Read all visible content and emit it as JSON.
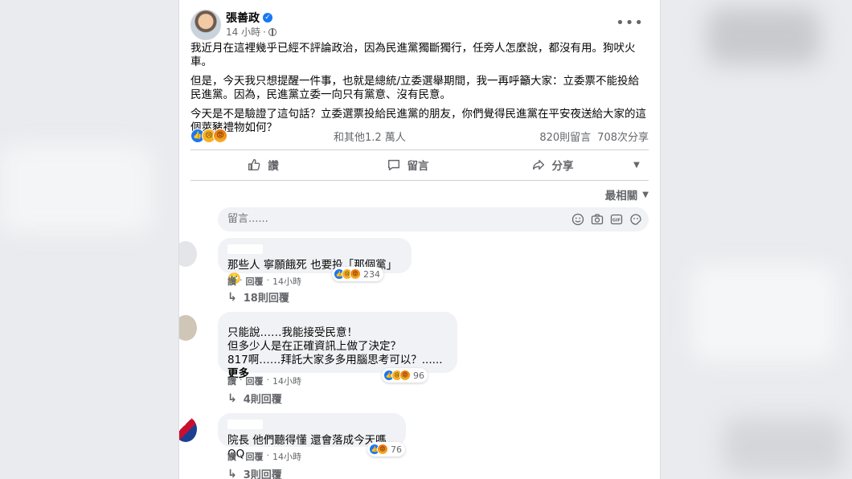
{
  "post": {
    "author": "張善政",
    "time": "14 小時",
    "dot": "·",
    "paragraphs": [
      "我近月在這裡幾乎已經不評論政治，因為民進黨獨斷獨行，任旁人怎麼說，都沒有用。狗吠火車。",
      "但是，今天我只想提醒一件事，也就是總統/立委選舉期間，我一再呼籲大家：立委票不能投給民進黨。因為，民進黨立委一向只有黨意、沒有民意。",
      "今天是不是驗證了這句話？立委選票投給民進黨的朋友，你們覺得民進黨在平安夜送給大家的這個萊豬禮物如何？"
    ],
    "reaction_others": "和其他1.2 萬人",
    "comments_count": "820則留言",
    "shares_count": "708次分享"
  },
  "actions": {
    "like": "讚",
    "comment": "留言",
    "share": "分享"
  },
  "sort_label": "最相關",
  "composer": {
    "placeholder": "留言......"
  },
  "comments": [
    {
      "text": "那些人 寧願餓死 也要投「那個黨」🙄",
      "reactions": "234",
      "like": "讚",
      "reply": "回覆",
      "time": "14小時",
      "replies": "18則回覆"
    },
    {
      "text": "只能說……我能接受民意！\n但多少人是在正確資訊上做了決定？\n817啊……拜託大家多多用腦思考可以？......",
      "more": "更多",
      "reactions": "96",
      "like": "讚",
      "reply": "回覆",
      "time": "14小時",
      "replies": "4則回覆"
    },
    {
      "text": "院長 他們聽得懂 還會落成今天嗎 QQ",
      "reactions": "76",
      "like": "讚",
      "reply": "回覆",
      "time": "14小時",
      "replies": "3則回覆"
    }
  ]
}
